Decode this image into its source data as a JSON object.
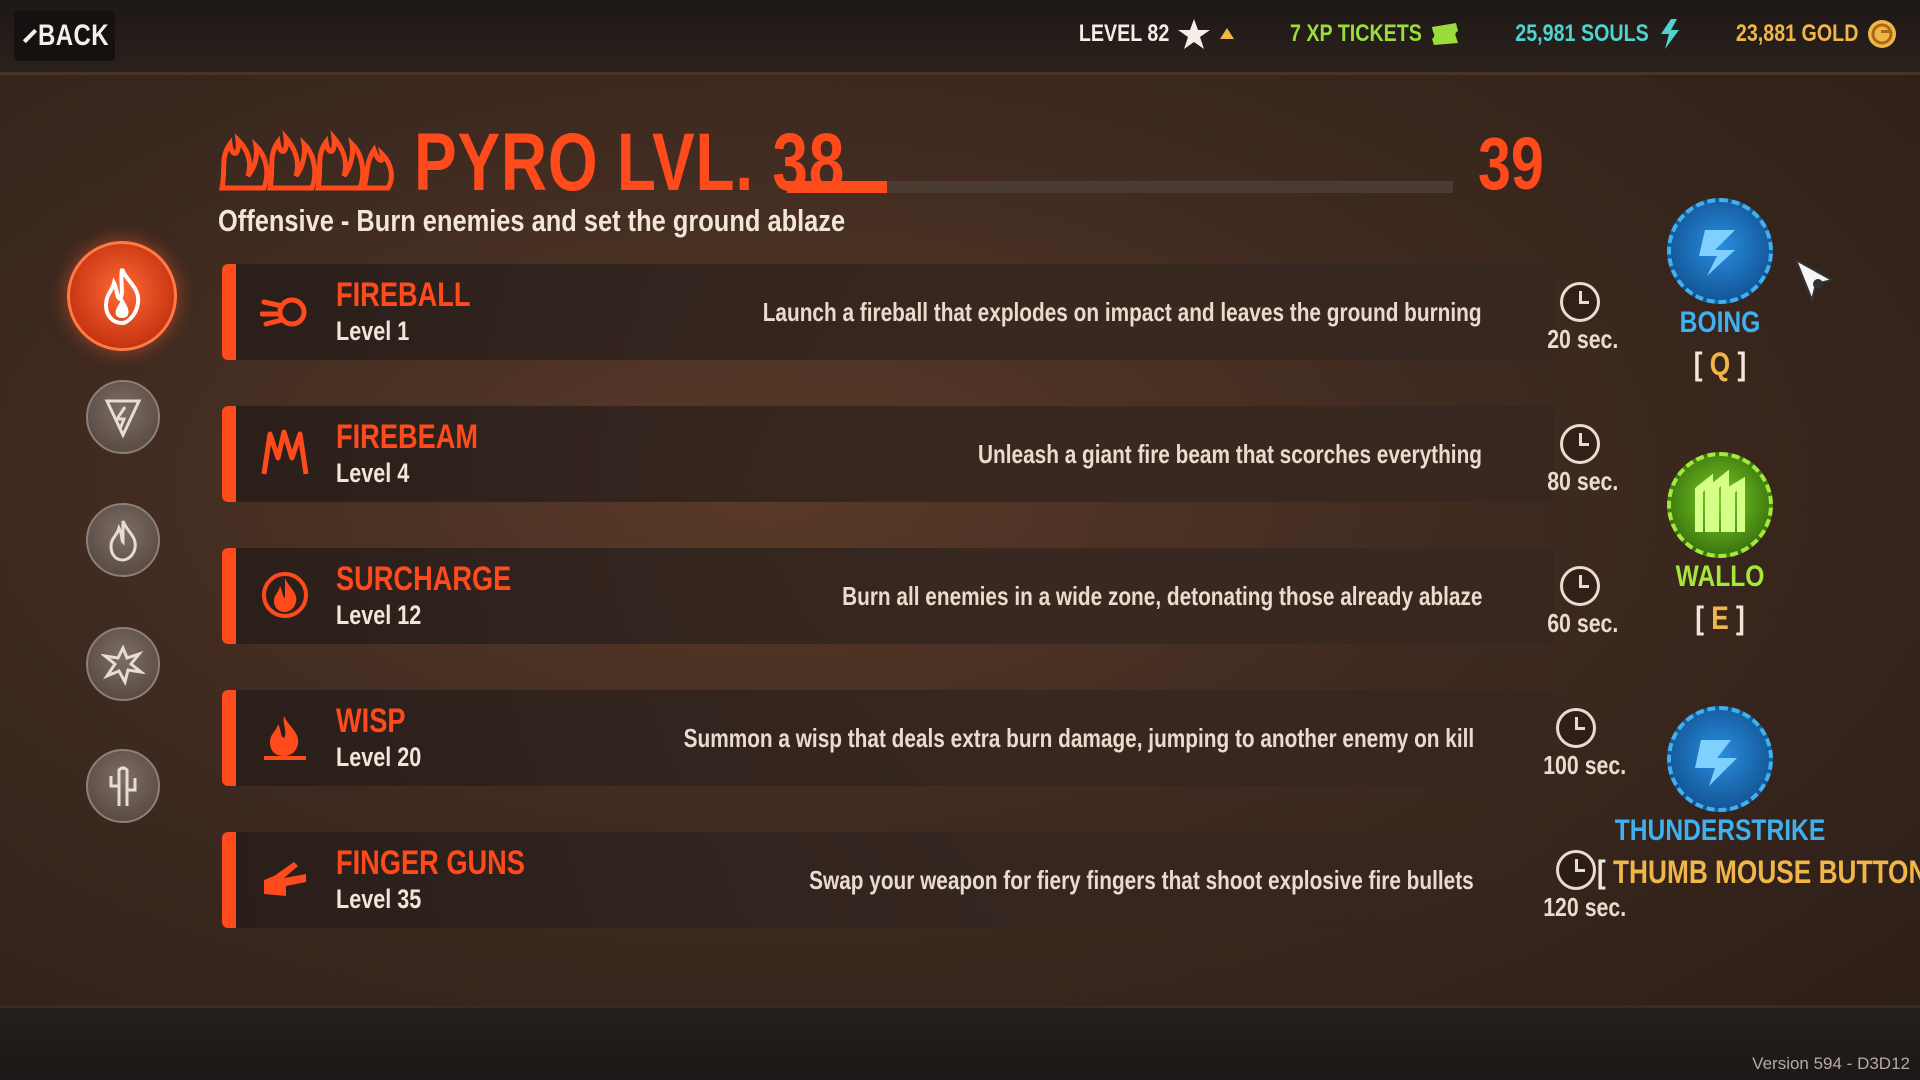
{
  "topbar": {
    "back_label": "BACK",
    "level_label": "LEVEL 82",
    "xp_tickets": "7 XP TICKETS",
    "souls": "25,981 SOULS",
    "gold": "23,881 GOLD",
    "icons": {
      "level": "star-icon",
      "xp": "ticket-icon",
      "souls": "soul-icon",
      "gold": "gold-coin-icon"
    }
  },
  "header": {
    "title": "PYRO LVL. 38",
    "next_level": "39",
    "xp_progress": 0.15,
    "subtitle": "Offensive - Burn enemies and set the ground ablaze"
  },
  "categories": [
    {
      "icon": "fire-icon",
      "active": true
    },
    {
      "icon": "lightning-shield-icon",
      "active": false
    },
    {
      "icon": "flame-drop-icon",
      "active": false
    },
    {
      "icon": "splat-icon",
      "active": false
    },
    {
      "icon": "cactus-icon",
      "active": false
    }
  ],
  "abilities": [
    {
      "name": "FIREBALL",
      "level": "Level 1",
      "description": "Launch a fireball that explodes on impact and leaves the ground burning",
      "cooldown": "20 sec.",
      "icon": "fireball-icon"
    },
    {
      "name": "FIREBEAM",
      "level": "Level 4",
      "description": "Unleash a giant fire beam that scorches everything",
      "cooldown": "80 sec.",
      "icon": "firebeam-icon"
    },
    {
      "name": "SURCHARGE",
      "level": "Level 12",
      "description": "Burn all enemies in a wide zone, detonating those already ablaze",
      "cooldown": "60 sec.",
      "icon": "surcharge-icon"
    },
    {
      "name": "WISP",
      "level": "Level 20",
      "description": "Summon a wisp that deals extra burn damage, jumping to another enemy on kill",
      "cooldown": "100 sec.",
      "icon": "wisp-icon"
    },
    {
      "name": "FINGER GUNS",
      "level": "Level 35",
      "description": "Swap your weapon for fiery fingers that shoot explosive fire bullets",
      "cooldown": "120 sec.",
      "icon": "finger-guns-icon"
    }
  ],
  "powers": [
    {
      "name": "BOING",
      "key": "Q",
      "color": "#2f9be0",
      "icon": "boing-icon"
    },
    {
      "name": "WALLO",
      "key": "E",
      "color": "#8fd62a",
      "icon": "wallo-icon"
    },
    {
      "name": "THUNDERSTRIKE",
      "key": "THUMB MOUSE BUTTON",
      "color": "#2f9be0",
      "icon": "thunderstrike-icon"
    }
  ],
  "version": "Version 594 - D3D12",
  "colors": {
    "accent": "#ff4a1c",
    "gold": "#f0b64a",
    "xp": "#9bdc3d",
    "souls": "#4fd3cf"
  }
}
